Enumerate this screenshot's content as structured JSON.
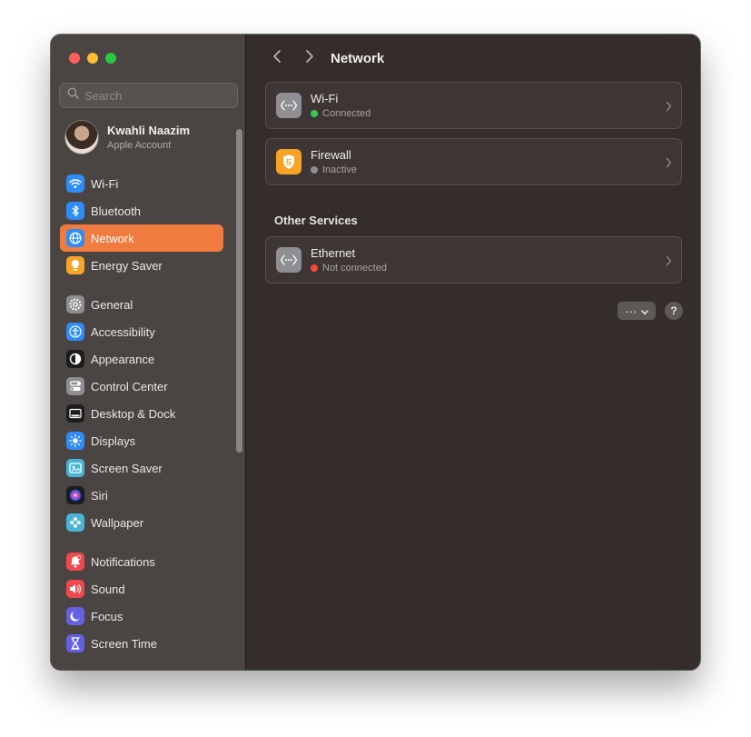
{
  "window": {
    "title": "Network"
  },
  "search": {
    "placeholder": "Search"
  },
  "account": {
    "name": "Kwahli Naazim",
    "subtitle": "Apple Account"
  },
  "sidebar": {
    "groups": [
      [
        {
          "label": "Wi-Fi",
          "icon": "wifi-icon",
          "color": "#2f8cf6"
        },
        {
          "label": "Bluetooth",
          "icon": "bluetooth-icon",
          "color": "#2f8cf6"
        },
        {
          "label": "Network",
          "icon": "globe-icon",
          "color": "#2f8cf6",
          "active": true
        },
        {
          "label": "Energy Saver",
          "icon": "lightbulb-icon",
          "color": "#f7a325"
        }
      ],
      [
        {
          "label": "General",
          "icon": "gear-icon",
          "color": "#8e8e93"
        },
        {
          "label": "Accessibility",
          "icon": "accessibility-icon",
          "color": "#2f8cf6"
        },
        {
          "label": "Appearance",
          "icon": "appearance-icon",
          "color": "#1c1c1e"
        },
        {
          "label": "Control Center",
          "icon": "control-center-icon",
          "color": "#8e8e93"
        },
        {
          "label": "Desktop & Dock",
          "icon": "dock-icon",
          "color": "#1c1c1e"
        },
        {
          "label": "Displays",
          "icon": "sun-icon",
          "color": "#2f8cf6"
        },
        {
          "label": "Screen Saver",
          "icon": "screen-saver-icon",
          "color": "#47b6d6"
        },
        {
          "label": "Siri",
          "icon": "siri-icon",
          "color": "#1c1c1e"
        },
        {
          "label": "Wallpaper",
          "icon": "wallpaper-icon",
          "color": "#47b6d6"
        }
      ],
      [
        {
          "label": "Notifications",
          "icon": "bell-icon",
          "color": "#f0484f"
        },
        {
          "label": "Sound",
          "icon": "speaker-icon",
          "color": "#f0484f"
        },
        {
          "label": "Focus",
          "icon": "moon-icon",
          "color": "#6461e0"
        },
        {
          "label": "Screen Time",
          "icon": "hourglass-icon",
          "color": "#6461e0"
        }
      ]
    ]
  },
  "services": [
    {
      "name": "Wi-Fi",
      "status": "Connected",
      "status_color": "#34c759",
      "icon": "network-dots-icon",
      "icon_color": "#8e8e93"
    },
    {
      "name": "Firewall",
      "status": "Inactive",
      "status_color": "#8e8e93",
      "icon": "firewall-shield-icon",
      "icon_color": "#f7a325"
    }
  ],
  "other_services": {
    "heading": "Other Services",
    "items": [
      {
        "name": "Ethernet",
        "status": "Not connected",
        "status_color": "#ff453a",
        "icon": "network-dots-icon",
        "icon_color": "#8e8e93"
      }
    ]
  },
  "actions": {
    "more_label": "···",
    "help_label": "?"
  },
  "colors": {
    "accent": "#ef7b3e",
    "window_bg": "#342d2c",
    "sidebar_bg": "#4a4443"
  }
}
